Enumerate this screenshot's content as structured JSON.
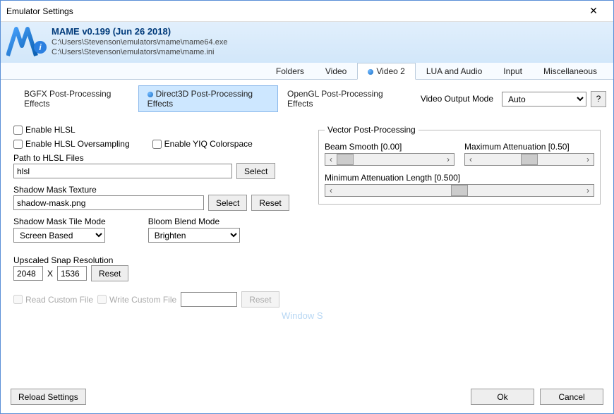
{
  "window": {
    "title": "Emulator Settings"
  },
  "header": {
    "app_title": "MAME v0.199 (Jun 26 2018)",
    "exe_path": "C:\\Users\\Stevenson\\emulators\\mame\\mame64.exe",
    "ini_path": "C:\\Users\\Stevenson\\emulators\\mame\\mame.ini"
  },
  "main_tabs": {
    "folders": "Folders",
    "video": "Video",
    "video2": "Video 2",
    "lua_audio": "LUA and Audio",
    "input": "Input",
    "misc": "Miscellaneous"
  },
  "sub_tabs": {
    "bgfx": "BGFX Post-Processing Effects",
    "d3d": "Direct3D Post-Processing Effects",
    "opengl": "OpenGL Post-Processing Effects"
  },
  "video_output": {
    "label": "Video Output Mode",
    "value": "Auto",
    "help": "?"
  },
  "checks": {
    "enable_hlsl": "Enable HLSL",
    "enable_oversampling": "Enable HLSL Oversampling",
    "enable_yiq": "Enable YIQ Colorspace"
  },
  "hlsl_path": {
    "label": "Path to HLSL Files",
    "value": "hlsl",
    "select": "Select"
  },
  "shadow_mask": {
    "label": "Shadow Mask Texture",
    "value": "shadow-mask.png",
    "select": "Select",
    "reset": "Reset"
  },
  "tile_mode": {
    "label": "Shadow Mask Tile Mode",
    "value": "Screen Based"
  },
  "bloom_mode": {
    "label": "Bloom Blend Mode",
    "value": "Brighten"
  },
  "snap_res": {
    "label": "Upscaled Snap Resolution",
    "w": "2048",
    "x": "X",
    "h": "1536",
    "reset": "Reset"
  },
  "custom": {
    "read": "Read Custom File",
    "write": "Write Custom File",
    "reset": "Reset"
  },
  "vector": {
    "legend": "Vector Post-Processing",
    "beam_smooth": "Beam Smooth [0.00]",
    "max_atten": "Maximum Attenuation [0.50]",
    "min_atten_len": "Minimum Attenuation Length [0.500]"
  },
  "buttons": {
    "reload": "Reload Settings",
    "ok": "Ok",
    "cancel": "Cancel"
  }
}
